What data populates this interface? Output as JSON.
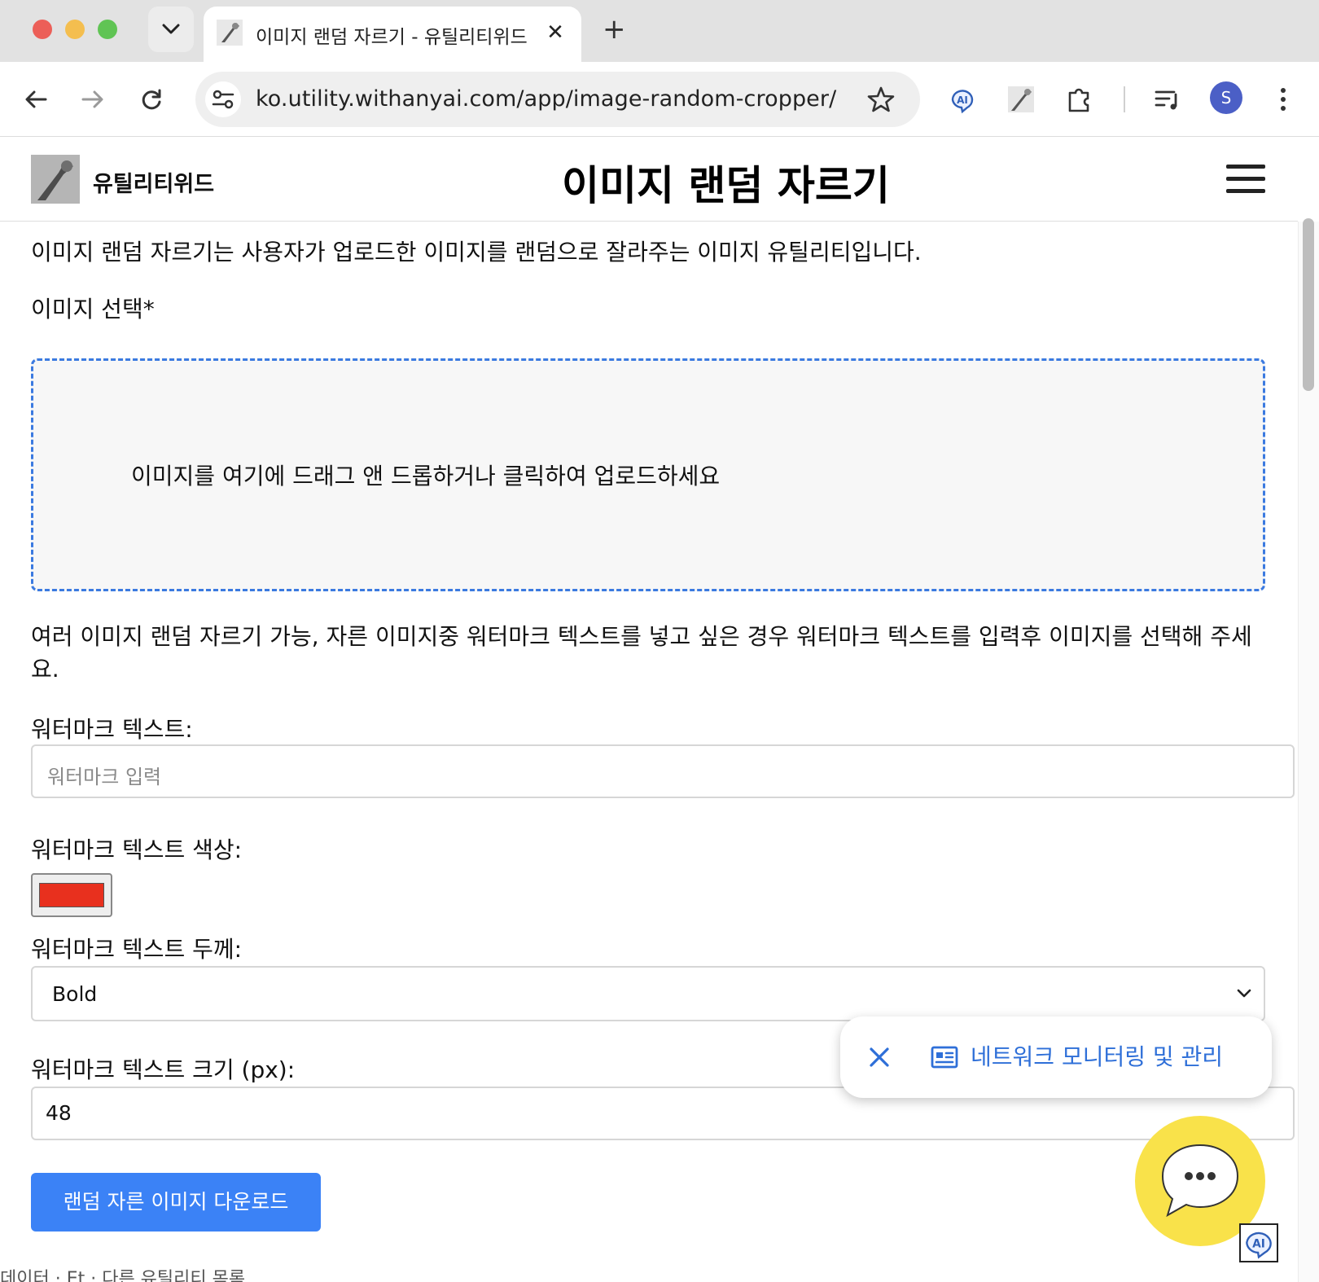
{
  "browser": {
    "tab_title": "이미지 랜덤 자르기 - 유틸리티위드",
    "tab_close_glyph": "✕",
    "new_tab_glyph": "+",
    "url": "ko.utility.withanyai.com/app/image-random-cropper/",
    "profile_initial": "S",
    "icons": [
      "back-icon",
      "forward-icon",
      "reload-icon",
      "site-info-icon",
      "bookmark-star-icon",
      "ai-extension-icon",
      "wrench-extension-icon",
      "extensions-puzzle-icon",
      "reading-list-icon",
      "kebab-menu-icon"
    ]
  },
  "header": {
    "brand": "유틸리티위드",
    "title": "이미지 랜덤 자르기"
  },
  "main": {
    "intro": "이미지 랜덤 자르기는 사용자가 업로드한 이미지를 랜덤으로 잘라주는 이미지 유틸리티입니다.",
    "select_label": "이미지 선택*",
    "dropzone_text": "이미지를 여기에 드래그 앤 드롭하거나 클릭하여 업로드하세요",
    "note": "여러 이미지 랜덤 자르기 가능, 자른 이미지중 워터마크 텍스트를 넣고 싶은 경우 워터마크 텍스트를 입력후 이미지를 선택해 주세요.",
    "watermark_text_label": "워터마크 텍스트:",
    "watermark_text_placeholder": "워터마크 입력",
    "watermark_color_label": "워터마크 텍스트 색상:",
    "watermark_color": "#e8301e",
    "watermark_weight_label": "워터마크 텍스트 두께:",
    "watermark_weight_value": "Bold",
    "watermark_size_label": "워터마크 텍스트 크기 (px):",
    "watermark_size_value": "48",
    "download_button": "랜덤 자른 이미지 다운로드",
    "bottom_cut_text": "데이터 · Et · 다른 유틸리티 목록"
  },
  "toast": {
    "label": "네트워크 모니터링 및 관리"
  },
  "colors": {
    "accent": "#3b82f6",
    "dropzone_border": "#3b7ae0",
    "toast_text": "#2e6fd8",
    "chat_fab": "#f9e24a"
  }
}
